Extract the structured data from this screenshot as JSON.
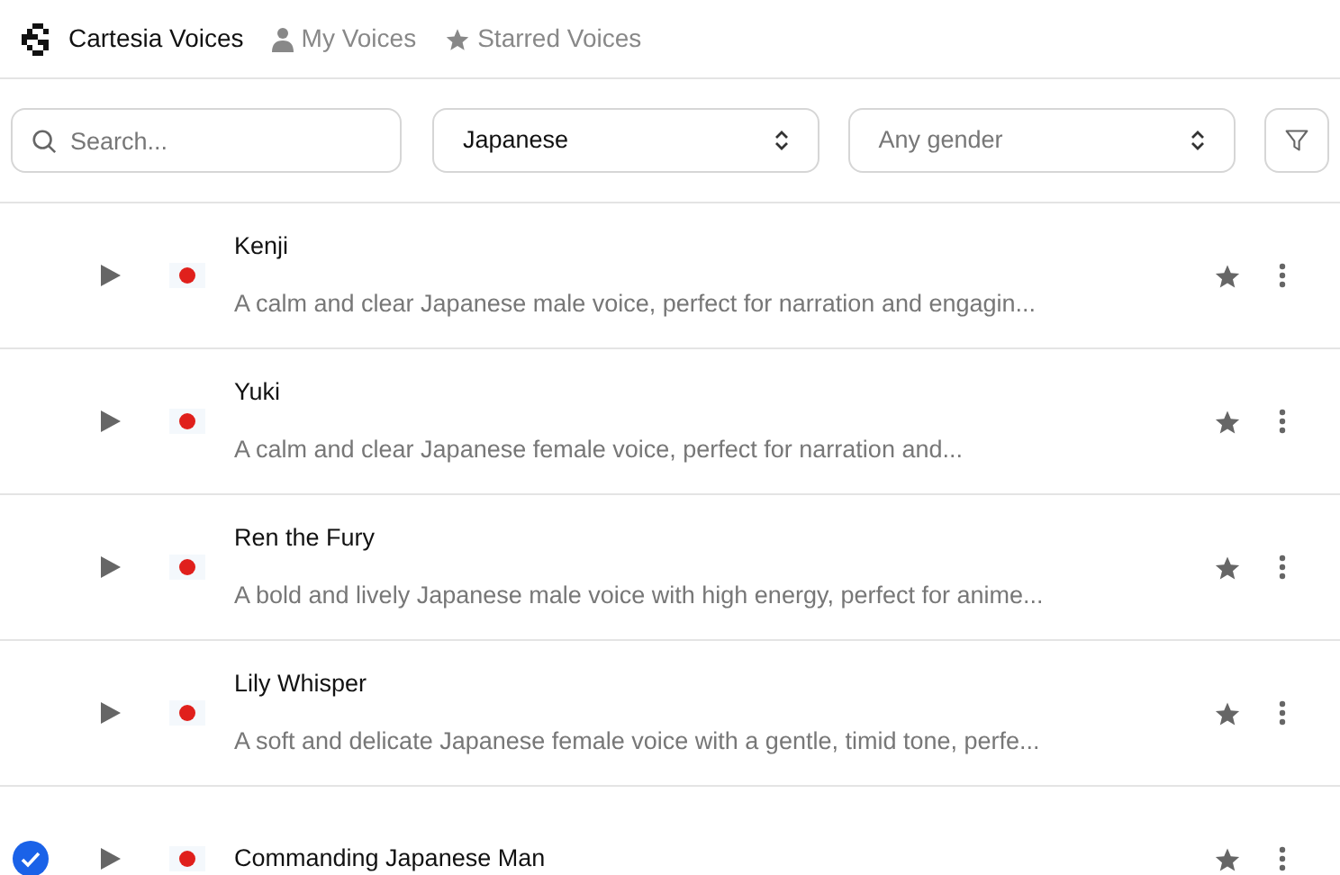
{
  "header": {
    "brand": "Cartesia Voices",
    "tabs": [
      {
        "label": "My Voices",
        "kind": "person"
      },
      {
        "label": "Starred Voices",
        "kind": "star"
      }
    ]
  },
  "filters": {
    "search": {
      "placeholder": "Search..."
    },
    "language": {
      "value": "Japanese"
    },
    "gender": {
      "placeholder": "Any gender"
    }
  },
  "voices": [
    {
      "name": "Kenji",
      "description": "A calm and clear Japanese male voice, perfect for narration and engagin...",
      "selected": false
    },
    {
      "name": "Yuki",
      "description": "A calm and clear Japanese female voice, perfect for narration and...",
      "selected": false
    },
    {
      "name": "Ren the Fury",
      "description": "A bold and lively Japanese male voice with high energy, perfect for anime...",
      "selected": false
    },
    {
      "name": "Lily Whisper",
      "description": "A soft and delicate Japanese female voice with a gentle, timid tone, perfe...",
      "selected": false
    },
    {
      "name": "Commanding Japanese Man",
      "selected": true
    }
  ]
}
